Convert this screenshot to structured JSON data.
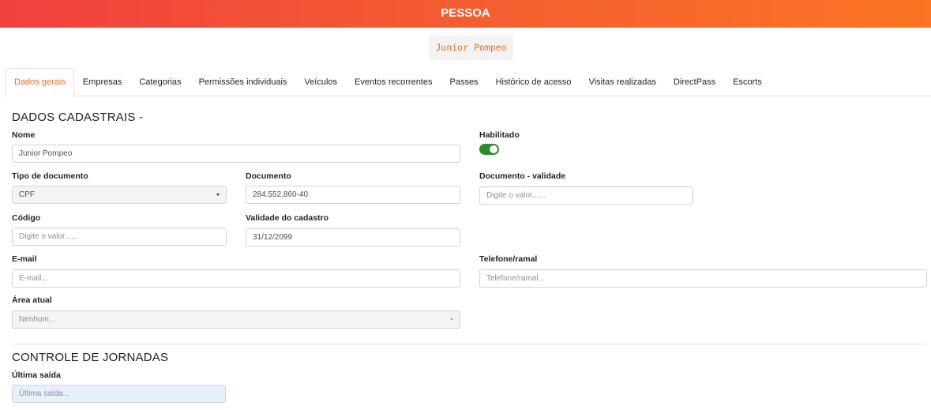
{
  "header": {
    "title": "PESSOA",
    "accent_color": "#f45a32"
  },
  "person": {
    "name_chip": "Junior Pompeo"
  },
  "tabs": [
    {
      "label": "Dados gerais",
      "active": true
    },
    {
      "label": "Empresas"
    },
    {
      "label": "Categorias"
    },
    {
      "label": "Permissões individuais"
    },
    {
      "label": "Veículos"
    },
    {
      "label": "Eventos recorrentes"
    },
    {
      "label": "Passes"
    },
    {
      "label": "Histórico de acesso"
    },
    {
      "label": "Visitas realizadas"
    },
    {
      "label": "DirectPass"
    },
    {
      "label": "Escorts"
    }
  ],
  "dados": {
    "title": "DADOS CADASTRAIS -",
    "nome": {
      "label": "Nome",
      "value": "Junior Pompeo"
    },
    "habilitado": {
      "label": "Habilitado",
      "checked": true,
      "color": "#2e8b2e"
    },
    "tipo_documento": {
      "label": "Tipo de documento",
      "value": "CPF"
    },
    "documento": {
      "label": "Documento",
      "value": "284.552.860-40"
    },
    "documento_validade": {
      "label": "Documento - validade",
      "placeholder": "Digite o valor......"
    },
    "codigo": {
      "label": "Código",
      "placeholder": "Digite o valor......"
    },
    "validade_cadastro": {
      "label": "Validade do cadastro",
      "value": "31/12/2099"
    },
    "email": {
      "label": "E-mail",
      "placeholder": "E-mail..."
    },
    "telefone": {
      "label": "Telefone/ramal",
      "placeholder": "Telefone/ramal..."
    },
    "area_atual": {
      "label": "Área atual",
      "placeholder": "Nenhum..."
    }
  },
  "jornadas": {
    "title": "CONTROLE DE JORNADAS",
    "ultima_saida": {
      "label": "Última saída",
      "placeholder": "Última saída..."
    }
  }
}
